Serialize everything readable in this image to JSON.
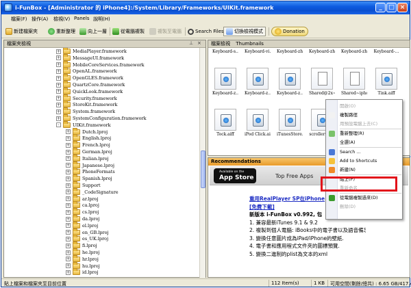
{
  "window": {
    "title": "i-FunBox - [Administrator 的 iPhone4]:/System/Library/Frameworks/UIKit.framework"
  },
  "menu": [
    "檔案(F)",
    "操作(A)",
    "檢視(V)",
    "Panels",
    "說明(H)"
  ],
  "toolbar": {
    "new_folder": "新建檔案夾",
    "refresh": "重新整理",
    "up": "向上一層",
    "copy_from_pc": "從電腦複製",
    "copy_to_pc": "複製至電腦",
    "search": "Search Files",
    "toggle_view": "切換檢視模式",
    "donation": "Donation"
  },
  "colors": {
    "accent": "#0a4fcf",
    "highlight": "#e2111a",
    "recommend": "#e89a2a"
  },
  "left_pane": {
    "title": "檔案夾檢視",
    "tree": [
      {
        "label": "MediaPlayer.framework",
        "level": 1,
        "expander": "+"
      },
      {
        "label": "MessageUI.framework",
        "level": 1,
        "expander": "+"
      },
      {
        "label": "MobileCoreServices.framework",
        "level": 1,
        "expander": "+"
      },
      {
        "label": "OpenAL.framework",
        "level": 1,
        "expander": "+"
      },
      {
        "label": "OpenGLES.framework",
        "level": 1,
        "expander": "+"
      },
      {
        "label": "QuartzCore.framework",
        "level": 1,
        "expander": "+"
      },
      {
        "label": "QuickLook.framework",
        "level": 1,
        "expander": "+"
      },
      {
        "label": "Security.framework",
        "level": 1,
        "expander": "+"
      },
      {
        "label": "StoreKit.framework",
        "level": 1,
        "expander": "+"
      },
      {
        "label": "System.framework",
        "level": 1,
        "expander": "+"
      },
      {
        "label": "SystemConfiguration.framework",
        "level": 1,
        "expander": "+"
      },
      {
        "label": "UIKit.framework",
        "level": 1,
        "expander": "-"
      },
      {
        "label": "Dutch.lproj",
        "level": 2,
        "expander": "+"
      },
      {
        "label": "English.lproj",
        "level": 2,
        "expander": "+"
      },
      {
        "label": "French.lproj",
        "level": 2,
        "expander": "+"
      },
      {
        "label": "German.lproj",
        "level": 2,
        "expander": "+"
      },
      {
        "label": "Italian.lproj",
        "level": 2,
        "expander": "+"
      },
      {
        "label": "Japanese.lproj",
        "level": 2,
        "expander": "+"
      },
      {
        "label": "PhoneFormats",
        "level": 2,
        "expander": "+"
      },
      {
        "label": "Spanish.lproj",
        "level": 2,
        "expander": "+"
      },
      {
        "label": "Support",
        "level": 2,
        "expander": "+"
      },
      {
        "label": "_CodeSignature",
        "level": 2,
        "expander": "+"
      },
      {
        "label": "ar.lproj",
        "level": 2,
        "expander": "+"
      },
      {
        "label": "ca.lproj",
        "level": 2,
        "expander": "+"
      },
      {
        "label": "cs.lproj",
        "level": 2,
        "expander": "+"
      },
      {
        "label": "da.lproj",
        "level": 2,
        "expander": "+"
      },
      {
        "label": "el.lproj",
        "level": 2,
        "expander": "+"
      },
      {
        "label": "en_GB.lproj",
        "level": 2,
        "expander": "+"
      },
      {
        "label": "es_UK.lproj",
        "level": 2,
        "expander": "+"
      },
      {
        "label": "fi.lproj",
        "level": 2,
        "expander": "+"
      },
      {
        "label": "he.lproj",
        "level": 2,
        "expander": "+"
      },
      {
        "label": "hr.lproj",
        "level": 2,
        "expander": "+"
      },
      {
        "label": "hu.lproj",
        "level": 2,
        "expander": "+"
      },
      {
        "label": "id.lproj",
        "level": 2,
        "expander": "+"
      }
    ]
  },
  "thumbnails": {
    "title": "檔案檢視",
    "view_label": "Thumbnails",
    "row1": [
      "Keyboard-s...",
      "Keyboard-vi...",
      "Keyboard-zh...",
      "Keyboard-zh...",
      "Keyboard-zh...",
      "Keyboard-..."
    ],
    "row2": [
      "Keyboard-z...",
      "Keyboard-z...",
      "Keyboard-z...",
      "Shared@2x~...",
      "Shared~ipho...",
      "Tink.aiff"
    ],
    "row3": [
      "Tock.aiff",
      "iPod Click.aiff",
      "iTunesStore...",
      "scrollerCli..."
    ]
  },
  "recommend": {
    "title": "Recommendations",
    "badge_small": "Available on the",
    "badge_big": "App Store",
    "top_free": "Top Free Apps",
    "lines": [
      "重用RealPlayer SP在iPhone",
      "[免費下載]",
      "新版本 i-FunBox v0.992, 包",
      "1. 兼容最新iTunes 9.1 & 9.2",
      "2. 複製到個人電腦: iBooks中的電子書以及語音備忘錄中的.m4a.",
      "3. 變換任意圖片成為iPad/iPhone的壁紙.",
      "4. 電子書和應用程式文件夾的圖標預覽.",
      "5. 變換二進制的plist為文本的xml"
    ]
  },
  "context_menu": {
    "items": [
      {
        "label": "開啟(O)",
        "disabled": true
      },
      {
        "label": "複製路徑",
        "disabled": false
      },
      {
        "label": "用預設電腦上去(C)",
        "disabled": true
      },
      {
        "label": "重新整理(R)",
        "disabled": false
      },
      {
        "label": "全選(A)",
        "disabled": false
      },
      {
        "label": "Search ...",
        "disabled": false
      },
      {
        "label": "Add to Shortcuts",
        "disabled": false
      },
      {
        "label": "新建(N)",
        "disabled": false
      },
      {
        "label": "貼上(P)",
        "disabled": false
      },
      {
        "label": "重新命名",
        "disabled": true
      },
      {
        "label": "從電腦複製過來(D)",
        "disabled": false
      },
      {
        "label": "刪除(D)",
        "disabled": true
      }
    ]
  },
  "status": {
    "hint": "貼上檔案和檔案夾至目前位置",
    "count": "112 Item(s)",
    "size": "1 KB",
    "free": "可用空間(剩餘/總共) : 6.65 GB/417.43 MB"
  }
}
